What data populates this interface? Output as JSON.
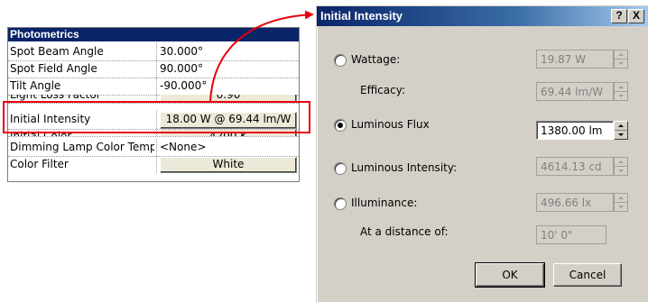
{
  "properties": {
    "header": "Photometrics",
    "rows": [
      {
        "name": "Spot Beam Angle",
        "value": "30.000°"
      },
      {
        "name": "Spot Field Angle",
        "value": "90.000°"
      },
      {
        "name": "Tilt Angle",
        "value": "-90.000°"
      },
      {
        "name": "Light Loss Factor",
        "value": "0.90"
      },
      {
        "name": "Initial Intensity",
        "value": "18.00 W @ 69.44 lm/W"
      },
      {
        "name": "Initial Color",
        "value": "4200 K"
      },
      {
        "name": "Dimming Lamp Color Temp",
        "value": "<None>"
      },
      {
        "name": "Color Filter",
        "value": "White"
      }
    ]
  },
  "dialog": {
    "title": "Initial Intensity",
    "help_button": "?",
    "close_button": "X",
    "wattage": {
      "label": "Wattage:",
      "value": "19.87 W",
      "selected": false
    },
    "efficacy": {
      "label": "Efficacy:",
      "value": "69.44 lm/W"
    },
    "luminous_flux": {
      "label": "Luminous Flux",
      "value": "1380.00 lm",
      "selected": true
    },
    "luminous_intensity": {
      "label": "Luminous Intensity:",
      "value": "4614.13 cd",
      "selected": false
    },
    "illuminance": {
      "label": "Illuminance:",
      "value": "496.66 lx",
      "selected": false
    },
    "distance": {
      "label": "At a distance of:",
      "value": "10'  0\""
    },
    "ok": "OK",
    "cancel": "Cancel"
  },
  "colors": {
    "highlight": "#e8000d",
    "title_bar": "#0a246a"
  }
}
